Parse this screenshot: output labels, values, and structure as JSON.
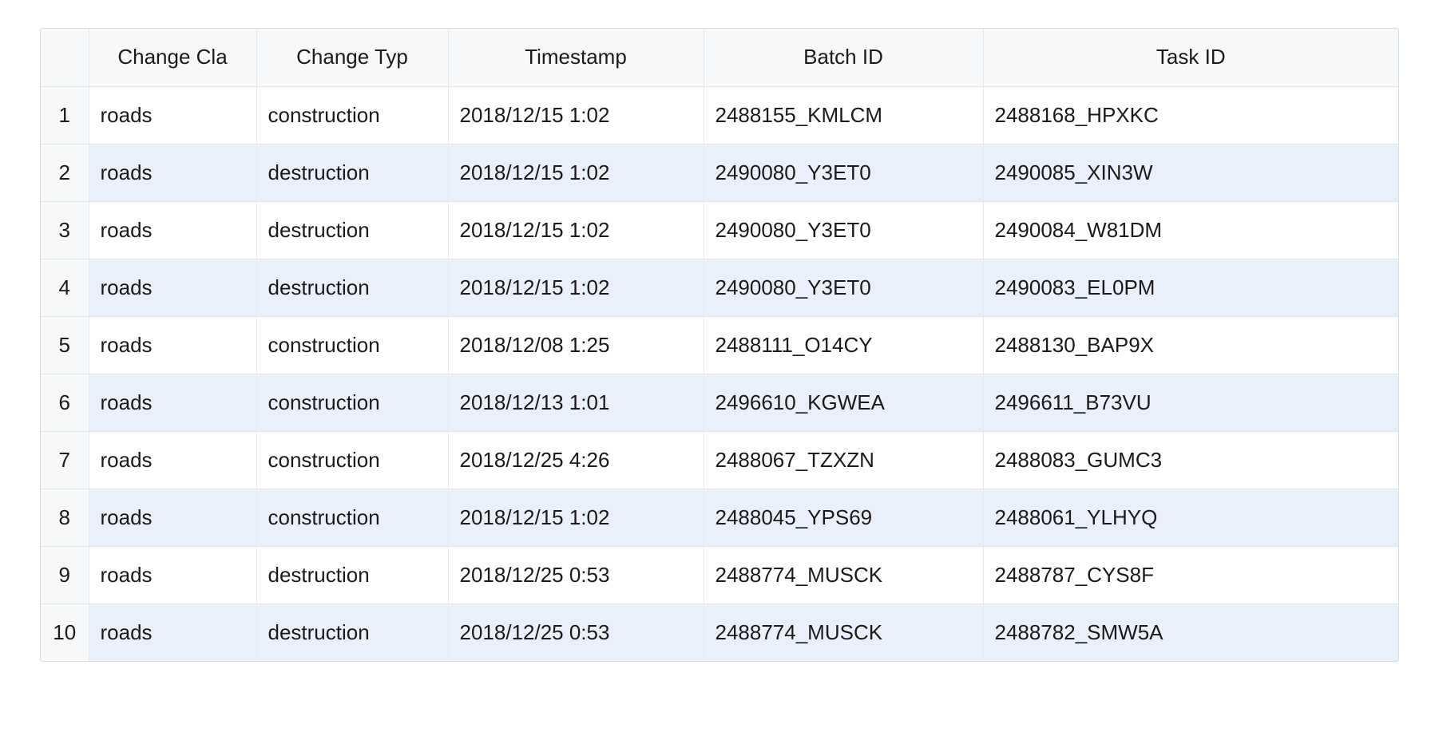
{
  "table": {
    "headers": {
      "rownum": "",
      "change_class": "Change Cla",
      "change_type": "Change Typ",
      "timestamp": "Timestamp",
      "batch_id": "Batch ID",
      "task_id": "Task ID"
    },
    "rows": [
      {
        "n": "1",
        "change_class": "roads",
        "change_type": "construction",
        "timestamp": "2018/12/15 1:02",
        "batch_id": "2488155_KMLCM",
        "task_id": "2488168_HPXKC"
      },
      {
        "n": "2",
        "change_class": "roads",
        "change_type": "destruction",
        "timestamp": "2018/12/15 1:02",
        "batch_id": "2490080_Y3ET0",
        "task_id": "2490085_XIN3W"
      },
      {
        "n": "3",
        "change_class": "roads",
        "change_type": "destruction",
        "timestamp": "2018/12/15 1:02",
        "batch_id": "2490080_Y3ET0",
        "task_id": "2490084_W81DM"
      },
      {
        "n": "4",
        "change_class": "roads",
        "change_type": "destruction",
        "timestamp": "2018/12/15 1:02",
        "batch_id": "2490080_Y3ET0",
        "task_id": "2490083_EL0PM"
      },
      {
        "n": "5",
        "change_class": "roads",
        "change_type": "construction",
        "timestamp": "2018/12/08 1:25",
        "batch_id": "2488111_O14CY",
        "task_id": "2488130_BAP9X"
      },
      {
        "n": "6",
        "change_class": "roads",
        "change_type": "construction",
        "timestamp": "2018/12/13 1:01",
        "batch_id": "2496610_KGWEA",
        "task_id": "2496611_B73VU"
      },
      {
        "n": "7",
        "change_class": "roads",
        "change_type": "construction",
        "timestamp": "2018/12/25 4:26",
        "batch_id": "2488067_TZXZN",
        "task_id": "2488083_GUMC3"
      },
      {
        "n": "8",
        "change_class": "roads",
        "change_type": "construction",
        "timestamp": "2018/12/15 1:02",
        "batch_id": "2488045_YPS69",
        "task_id": "2488061_YLHYQ"
      },
      {
        "n": "9",
        "change_class": "roads",
        "change_type": "destruction",
        "timestamp": "2018/12/25 0:53",
        "batch_id": "2488774_MUSCK",
        "task_id": "2488787_CYS8F"
      },
      {
        "n": "10",
        "change_class": "roads",
        "change_type": "destruction",
        "timestamp": "2018/12/25 0:53",
        "batch_id": "2488774_MUSCK",
        "task_id": "2488782_SMW5A"
      }
    ]
  }
}
